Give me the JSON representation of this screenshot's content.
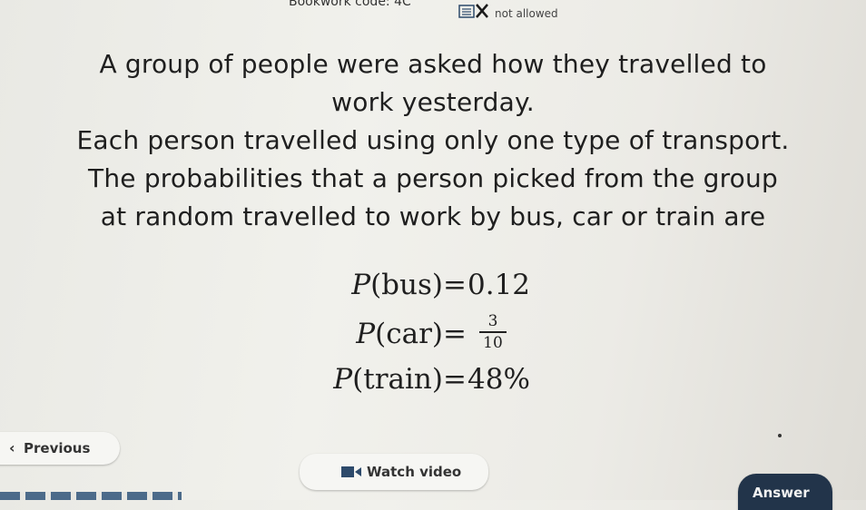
{
  "header": {
    "bookwork": "Bookwork code: 4C",
    "calculator": "not allowed"
  },
  "question": {
    "lines": [
      "A group of people were asked how they travelled to",
      "work yesterday.",
      "Each person travelled using only one type of transport.",
      "The probabilities that a person picked from the group",
      "at random travelled to work by bus, car or train are"
    ]
  },
  "probabilities": {
    "bus": {
      "fn": "P",
      "arg": "bus",
      "value": "0.12"
    },
    "car": {
      "fn": "P",
      "arg": "car",
      "numerator": "3",
      "denominator": "10"
    },
    "train": {
      "fn": "P",
      "arg": "train",
      "value": "48%"
    }
  },
  "nav": {
    "previous": "Previous",
    "watch_video": "Watch video",
    "answer": "Answer"
  },
  "colors": {
    "answer_bg": "#22344a",
    "icon": "#2d4a6b"
  }
}
